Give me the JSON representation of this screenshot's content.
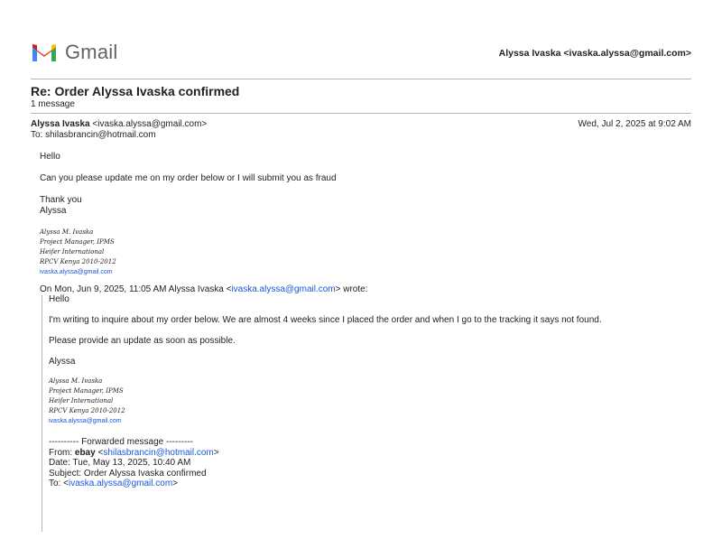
{
  "header": {
    "logo_text": "Gmail",
    "account": "Alyssa Ivaska <ivaska.alyssa@gmail.com>"
  },
  "thread": {
    "subject": "Re: Order Alyssa Ivaska confirmed",
    "count": "1 message"
  },
  "message": {
    "from_name": "Alyssa Ivaska",
    "from_email": "<ivaska.alyssa@gmail.com>",
    "to": "To: shilasbrancin@hotmail.com",
    "date": "Wed, Jul 2, 2025 at 9:02 AM",
    "greeting": "Hello",
    "body": "Can you please update me on my order below or I will submit you as fraud",
    "closing1": "Thank you",
    "closing2": "Alyssa",
    "signature": {
      "name": "Alyssa M. Ivaska",
      "title": "Project Manager, IPMS",
      "org": "Heifer International",
      "rpcv": "RPCV Kenya 2010-2012",
      "email": "ivaska.alyssa@gmail.com"
    }
  },
  "quoted": {
    "header_prefix": "On Mon, Jun 9, 2025, 11:05 AM Alyssa Ivaska <",
    "header_email": "ivaska.alyssa@gmail.com",
    "header_suffix": "> wrote:",
    "greeting": "Hello",
    "body": "I'm writing to inquire about my order below. We are almost 4 weeks since I placed the order and when I go to the tracking it says not found.",
    "request": "Please provide an update as soon as possible.",
    "closing": "Alyssa",
    "signature": {
      "name": "Alyssa M. Ivaska",
      "title": "Project Manager, IPMS",
      "org": "Heifer International",
      "rpcv": "RPCV Kenya 2010-2012",
      "email": "ivaska.alyssa@gmail.com"
    },
    "forwarded": {
      "separator": "---------- Forwarded message ---------",
      "from_label": "From: ",
      "from_name": "ebay",
      "from_email_open": " <",
      "from_email": "shilasbrancin@hotmail.com",
      "from_email_close": ">",
      "date": "Date: Tue, May 13, 2025, 10:40 AM",
      "subject": "Subject: Order Alyssa Ivaska confirmed",
      "to_label": "To: <",
      "to_email": "ivaska.alyssa@gmail.com",
      "to_close": ">"
    }
  }
}
